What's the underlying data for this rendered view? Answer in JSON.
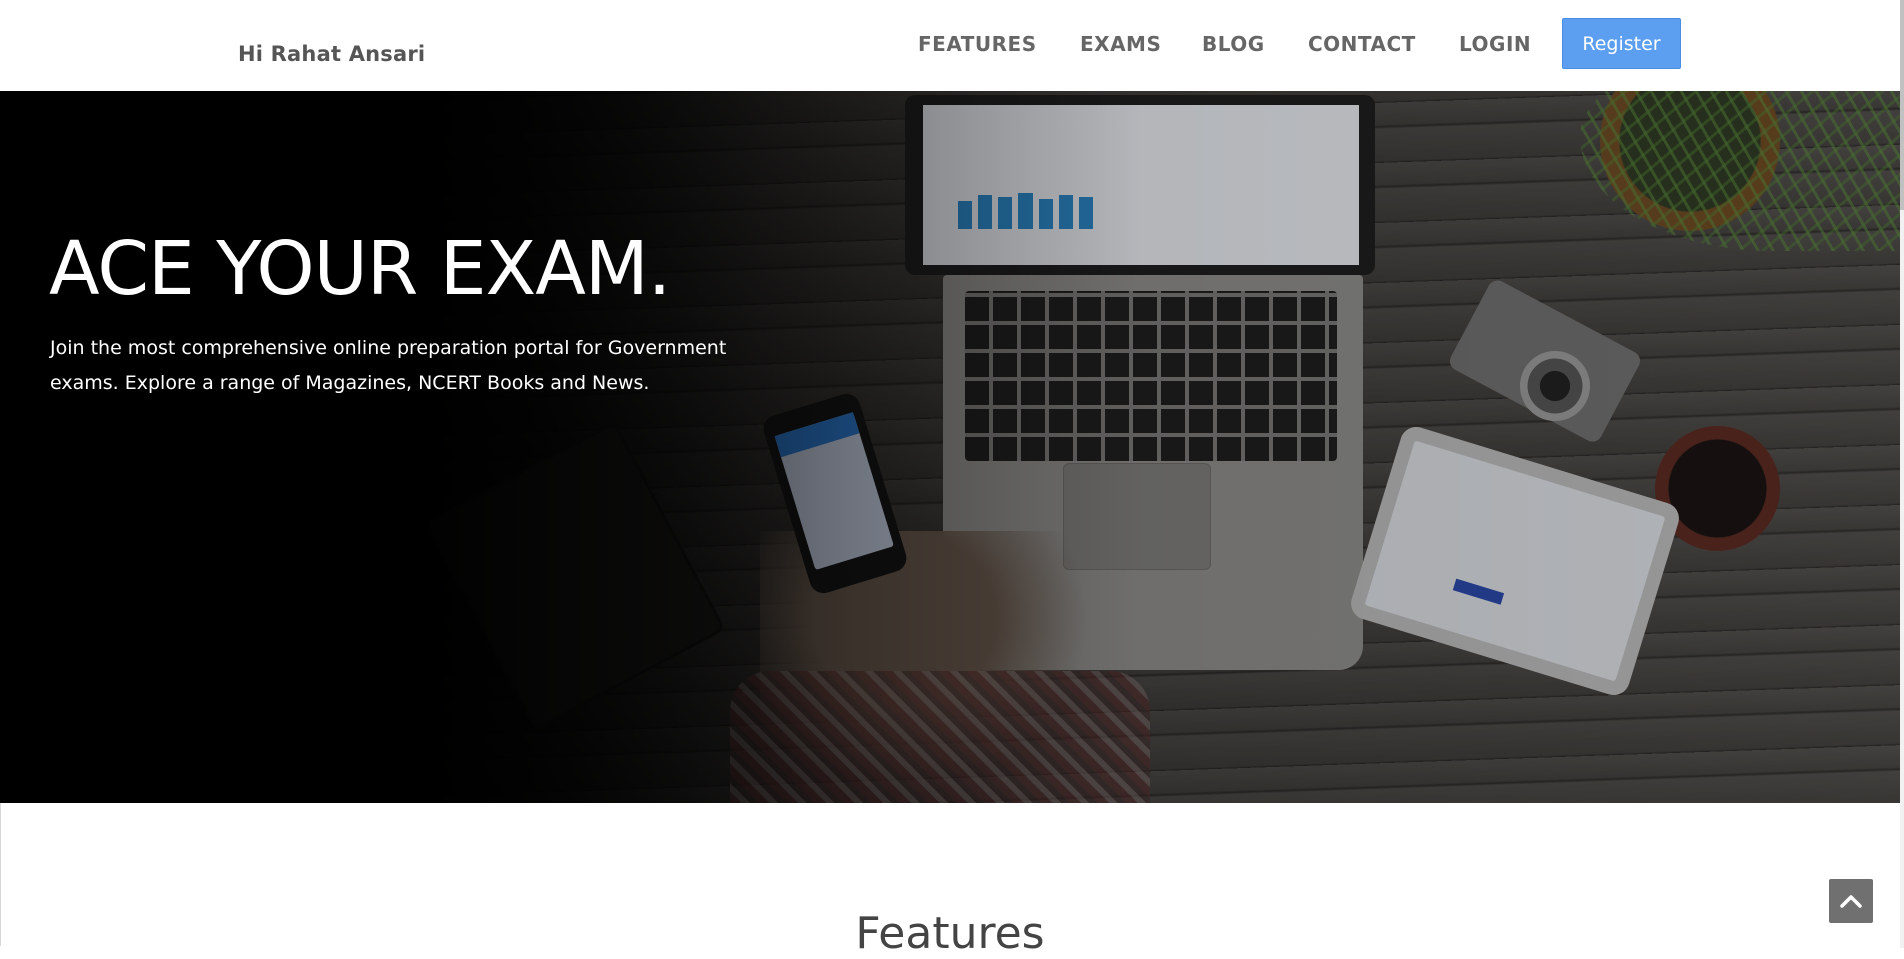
{
  "header": {
    "greeting": "Hi Rahat Ansari",
    "nav": [
      {
        "id": "features",
        "label": "FEATURES"
      },
      {
        "id": "exams",
        "label": "EXAMS"
      },
      {
        "id": "blog",
        "label": "BLOG"
      },
      {
        "id": "contact",
        "label": "CONTACT"
      },
      {
        "id": "login",
        "label": "LOGIN"
      }
    ],
    "register_label": "Register"
  },
  "hero": {
    "title": "ACE YOUR EXAM.",
    "subtitle": "Join the most comprehensive online preparation portal for Government exams. Explore a range of Magazines, NCERT Books and News."
  },
  "features": {
    "title": "Features"
  },
  "icons": {
    "scroll_top": "chevron-up-icon"
  },
  "colors": {
    "register_bg": "#5c9eef",
    "nav_text": "#666666",
    "scroll_top_bg": "#707070"
  }
}
